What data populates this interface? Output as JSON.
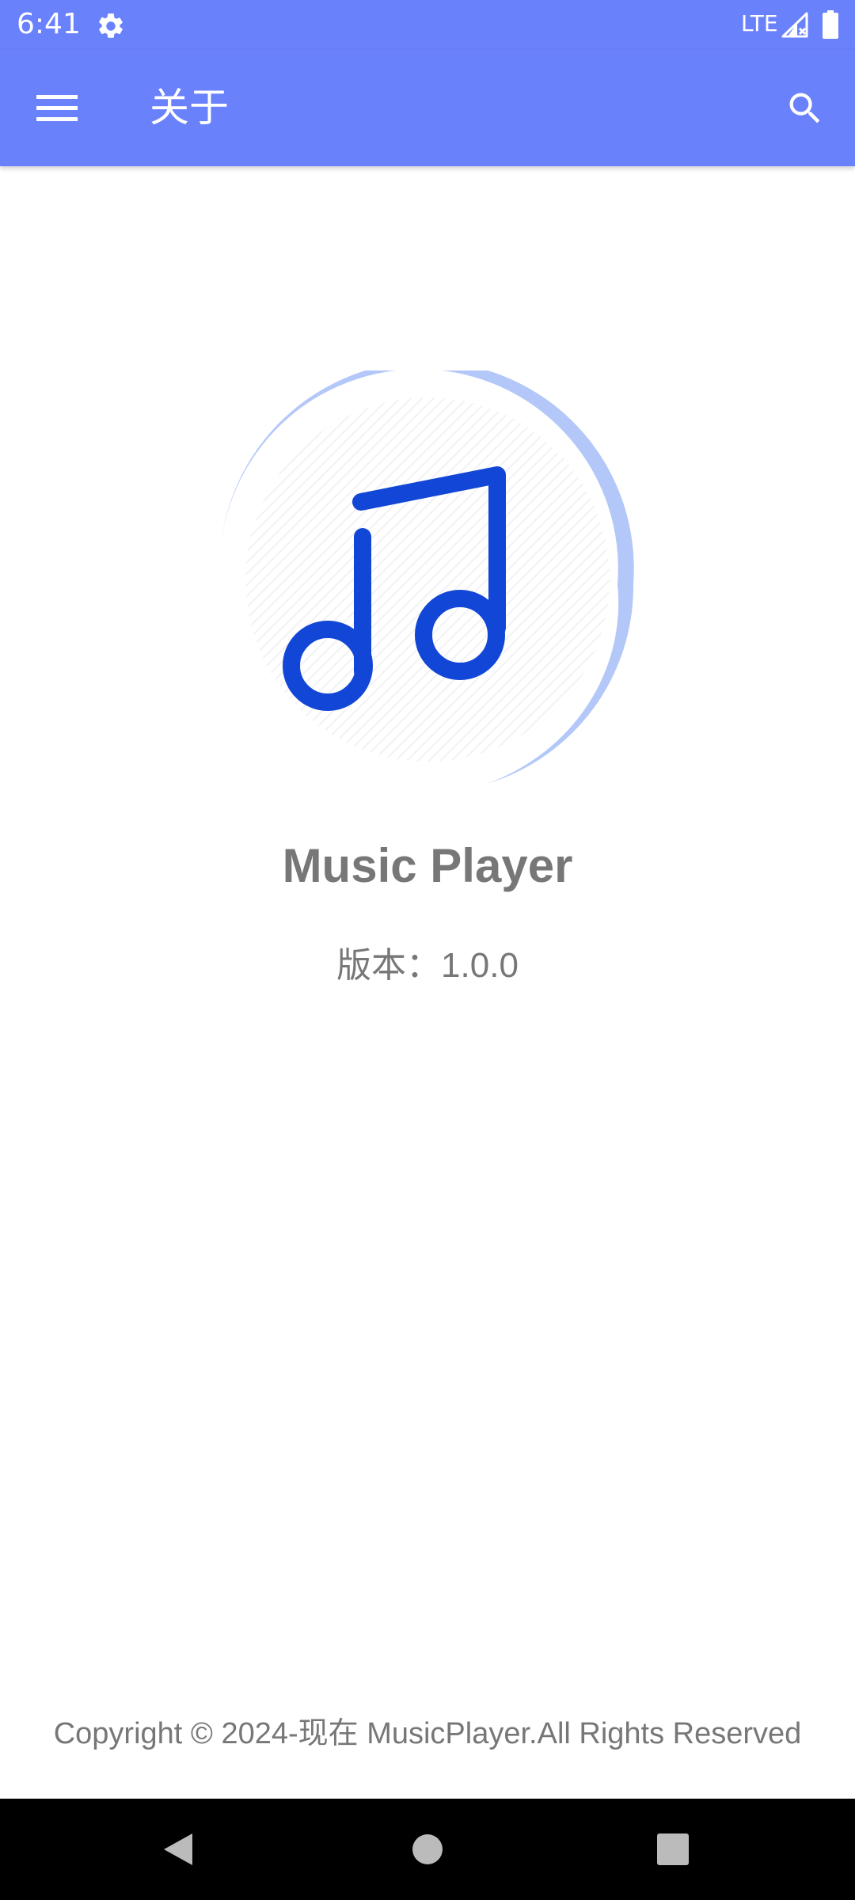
{
  "status_bar": {
    "time": "6:41",
    "network": "LTE",
    "icons": [
      "gear-icon",
      "signal-icon",
      "battery-icon"
    ]
  },
  "app_bar": {
    "title": "关于",
    "menu_icon": "hamburger-menu-icon",
    "search_icon": "search-icon"
  },
  "about": {
    "logo_icon": "music-note-icon",
    "app_name": "Music Player",
    "version": "版本：1.0.0",
    "copyright": "Copyright © 2024-现在 MusicPlayer.All Rights Reserved"
  },
  "nav_bar": {
    "icons": [
      "back-icon",
      "home-icon",
      "recents-icon"
    ]
  },
  "colors": {
    "primary": "#6a81fc",
    "logo_blue": "#1246d6",
    "logo_ring": "#b3c8f8",
    "text_gray": "#777777",
    "nav_background": "#000000"
  }
}
